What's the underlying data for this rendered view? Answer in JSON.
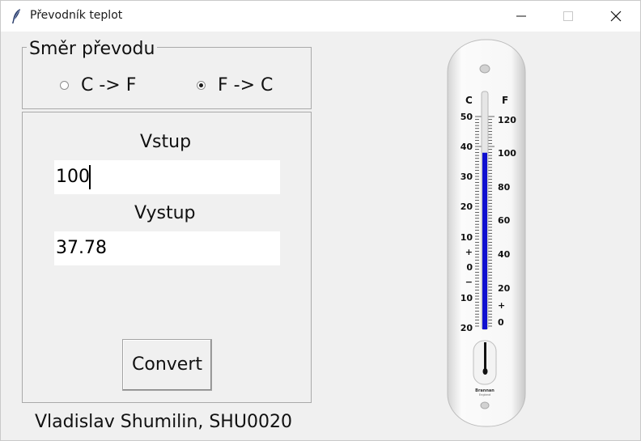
{
  "window": {
    "title": "Převodník teplot"
  },
  "direction": {
    "legend": "Směr převodu",
    "options": [
      {
        "label": "C -> F",
        "selected": false
      },
      {
        "label": "F -> C",
        "selected": true
      }
    ]
  },
  "io": {
    "input_label": "Vstup",
    "input_value": "100",
    "output_label": "Vystup",
    "output_value": "37.78"
  },
  "convert_button": "Convert",
  "footer": "Vladislav Shumilin, SHU0020",
  "thermometer": {
    "c_label": "C",
    "f_label": "F",
    "c_scale": [
      "50",
      "40",
      "30",
      "20",
      "10",
      "+",
      "0",
      "−",
      "10",
      "20"
    ],
    "f_scale": [
      "120",
      "100",
      "80",
      "60",
      "40",
      "20",
      "+",
      "0"
    ],
    "brand": "Brannan",
    "brand_sub": "England",
    "fill_color": "#1010d0",
    "reading_celsius": 38
  }
}
